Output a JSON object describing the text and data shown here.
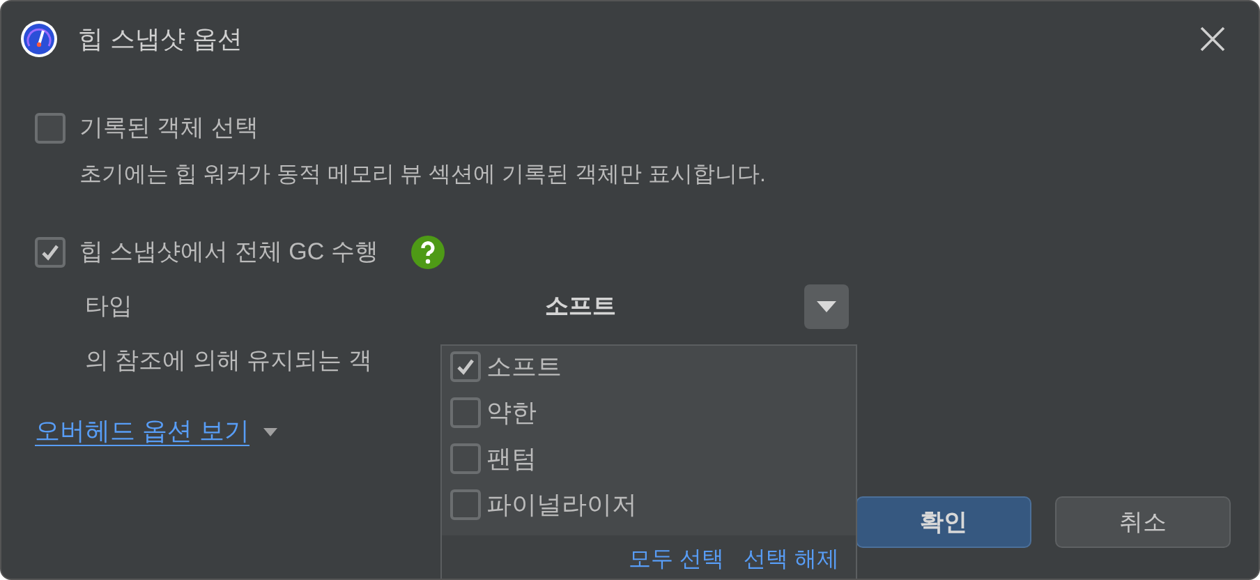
{
  "window": {
    "title": "힙 스냅샷 옵션"
  },
  "options": [
    {
      "kind": "checkbox",
      "label": "기록된 객체 선택",
      "checked": false,
      "description": "초기에는 힙 워커가 동적 메모리 뷰 섹션에 기록된 객체만 표시합니다."
    },
    {
      "kind": "checkbox",
      "label": "힙 스냅샷에서 전체 GC 수행",
      "checked": true,
      "help": true
    }
  ],
  "type_row": {
    "label": "타입",
    "value": "소프트"
  },
  "partial_label": "의 참조에 의해 유지되는 객",
  "overhead_link": "오버헤드 옵션 보기",
  "type_popup": {
    "items": [
      {
        "label": "소프트",
        "checked": true
      },
      {
        "label": "약한",
        "checked": false
      },
      {
        "label": "팬텀",
        "checked": false
      },
      {
        "label": "파이널라이저",
        "checked": false
      }
    ],
    "select_all": "모두 선택",
    "deselect_all": "선택 해제"
  },
  "buttons": [
    {
      "label": "확인",
      "kind": "primary"
    },
    {
      "label": "취소",
      "kind": "secondary"
    }
  ]
}
